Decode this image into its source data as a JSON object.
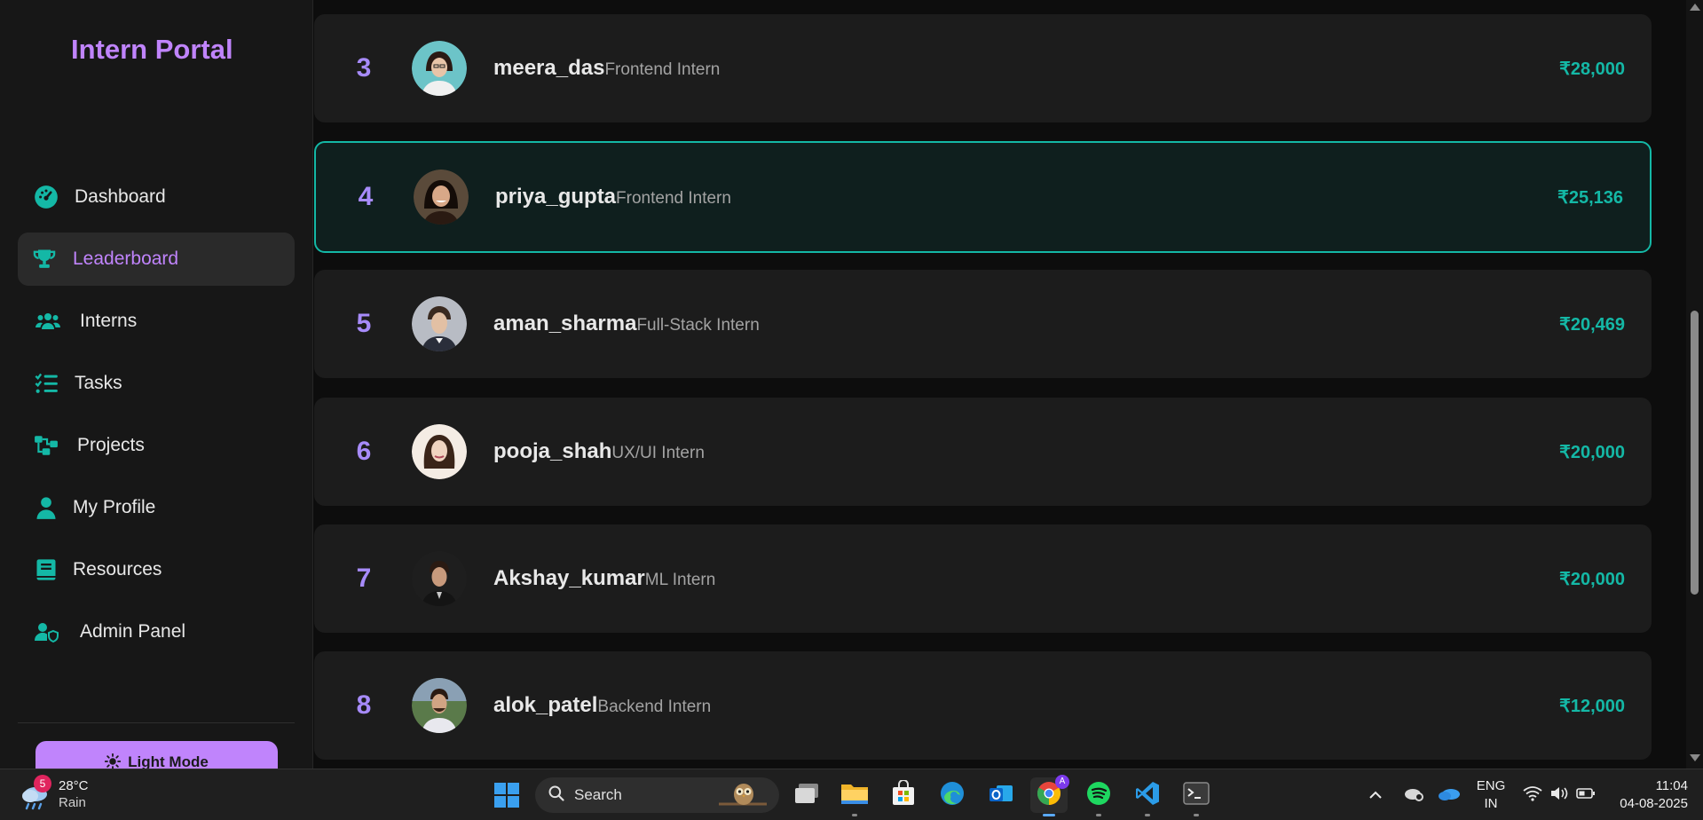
{
  "sidebar": {
    "brand": "Intern Portal",
    "items": [
      {
        "label": "Dashboard",
        "icon": "gauge-icon"
      },
      {
        "label": "Leaderboard",
        "icon": "trophy-icon",
        "active": true
      },
      {
        "label": "Interns",
        "icon": "users-icon"
      },
      {
        "label": "Tasks",
        "icon": "list-check-icon"
      },
      {
        "label": "Projects",
        "icon": "diagram-icon"
      },
      {
        "label": "My Profile",
        "icon": "user-icon"
      },
      {
        "label": "Resources",
        "icon": "book-icon"
      },
      {
        "label": "Admin Panel",
        "icon": "user-shield-icon"
      }
    ],
    "mode_button": "Light Mode"
  },
  "leaderboard": {
    "rows": [
      {
        "rank": "3",
        "username": "meera_das",
        "role": "Frontend Intern",
        "amount": "₹28,000"
      },
      {
        "rank": "4",
        "username": "priya_gupta",
        "role": "Frontend Intern",
        "amount": "₹25,136",
        "highlighted": true
      },
      {
        "rank": "5",
        "username": "aman_sharma",
        "role": "Full-Stack Intern",
        "amount": "₹20,469"
      },
      {
        "rank": "6",
        "username": "pooja_shah",
        "role": "UX/UI Intern",
        "amount": "₹20,000"
      },
      {
        "rank": "7",
        "username": "Akshay_kumar",
        "role": "ML Intern",
        "amount": "₹20,000"
      },
      {
        "rank": "8",
        "username": "alok_patel",
        "role": "Backend Intern",
        "amount": "₹12,000"
      }
    ]
  },
  "taskbar": {
    "weather": {
      "temp": "28°C",
      "condition": "Rain",
      "badge": "5"
    },
    "search_placeholder": "Search",
    "language": {
      "line1": "ENG",
      "line2": "IN"
    },
    "time": "11:04",
    "date": "04-08-2025",
    "chrome_badge": "A"
  },
  "colors": {
    "accent_purple": "#c084fc",
    "accent_teal": "#14b8a6",
    "rank_purple": "#a78bfa"
  }
}
